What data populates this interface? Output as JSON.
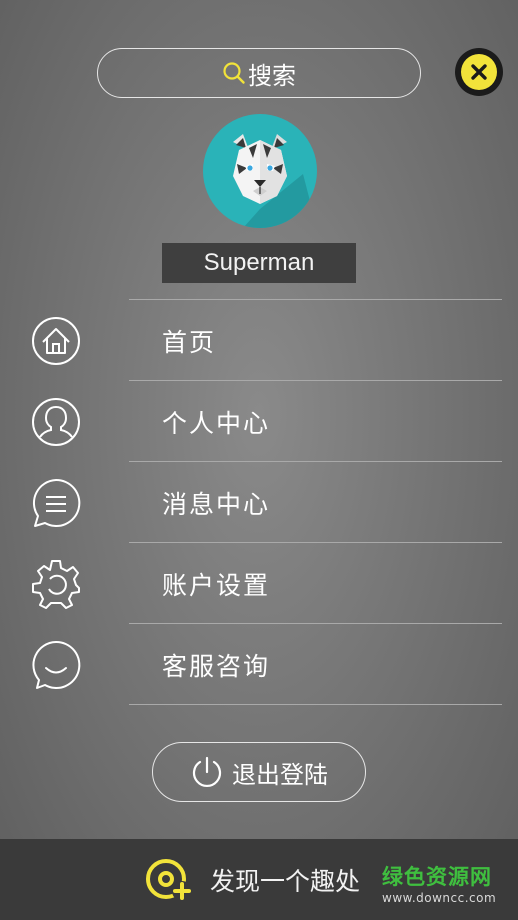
{
  "search": {
    "label": "搜索",
    "icon": "search-icon",
    "accent": "#f2e33a"
  },
  "close": {
    "icon": "close-icon",
    "accent": "#f2e33a"
  },
  "profile": {
    "username": "Superman",
    "avatar_bg": "#2ab3b8"
  },
  "menu": {
    "items": [
      {
        "label": "首页",
        "icon": "home-icon"
      },
      {
        "label": "个人中心",
        "icon": "user-icon"
      },
      {
        "label": "消息中心",
        "icon": "message-icon"
      },
      {
        "label": "账户设置",
        "icon": "gear-icon"
      },
      {
        "label": "客服咨询",
        "icon": "chat-smile-icon"
      }
    ]
  },
  "logout": {
    "label": "退出登陆",
    "icon": "power-icon"
  },
  "footer": {
    "label": "发现一个趣处",
    "icon": "discover-add-icon",
    "accent": "#f2e33a",
    "watermark_title": "绿色资源网",
    "watermark_url": "www.downcc.com",
    "watermark_color": "#3fbf3f"
  }
}
